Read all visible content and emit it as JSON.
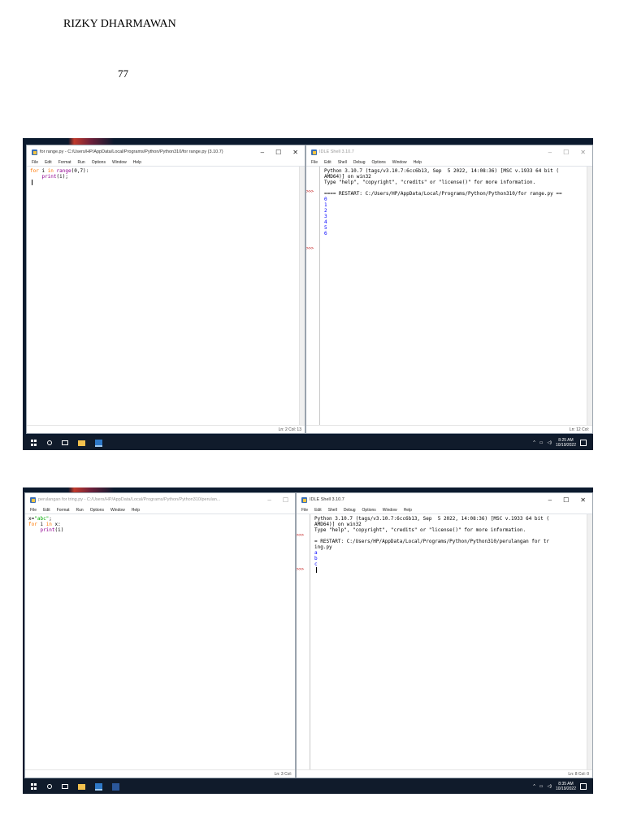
{
  "document": {
    "header": "RIZKY DHARMAWAN",
    "page_number": "77"
  },
  "screenshot1": {
    "editor": {
      "title": "for range.py - C:/Users/HP/AppData/Local/Programs/Python/Python310/for range.py (3.10.7)",
      "controls": {
        "minimize": "–",
        "maximize": "☐",
        "close": "✕"
      },
      "menu": [
        "File",
        "Edit",
        "Format",
        "Run",
        "Options",
        "Window",
        "Help"
      ],
      "code": {
        "kw_for": "for",
        "var_i": " i ",
        "kw_in": "in",
        "fn_range": " range",
        "range_args": "(0,7):",
        "indent": "    ",
        "fn_print": "print",
        "print_args": "(i);"
      },
      "status": "Ln: 2   Col: 13"
    },
    "shell": {
      "title": "IDLE Shell 3.10.7",
      "controls": {
        "minimize": "–",
        "maximize": "☐",
        "close": "✕"
      },
      "menu": [
        "File",
        "Edit",
        "Shell",
        "Debug",
        "Options",
        "Window",
        "Help"
      ],
      "banner": [
        "Python 3.10.7 (tags/v3.10.7:6cc6b13, Sep  5 2022, 14:08:36) [MSC v.1933 64 bit (",
        "AMD64)] on win32",
        "Type \"help\", \"copyright\", \"credits\" or \"license()\" for more information."
      ],
      "restart": "==== RESTART: C:/Users/HP/AppData/Local/Programs/Python/Python310/for range.py ==",
      "output": [
        "0",
        "1",
        "2",
        "3",
        "4",
        "5",
        "6"
      ],
      "prompt": ">>>",
      "status": "Ln: 12   Col: "
    },
    "taskbar": {
      "time": "8:25 AM",
      "date": "10/19/2022"
    }
  },
  "screenshot2": {
    "editor": {
      "title": "perulangan for tring.py - C:/Users/HP/AppData/Local/Programs/Python/Python310/perulan...",
      "controls": {
        "minimize": "–",
        "maximize": "☐"
      },
      "menu": [
        "File",
        "Edit",
        "Format",
        "Run",
        "Options",
        "Window",
        "Help"
      ],
      "code": {
        "assign": "x=",
        "str_val": "\"abc\"",
        "semi": ";",
        "kw_for": "for",
        "var_i": " i ",
        "kw_in": "in",
        "iter": " x:",
        "indent": "    ",
        "fn_print": "print",
        "print_args": "(i)"
      },
      "status": "Ln: 3   Col: "
    },
    "shell": {
      "title": "IDLE Shell 3.10.7",
      "controls": {
        "minimize": "–",
        "maximize": "☐",
        "close": "✕"
      },
      "menu": [
        "File",
        "Edit",
        "Shell",
        "Debug",
        "Options",
        "Window",
        "Help"
      ],
      "banner": [
        "Python 3.10.7 (tags/v3.10.7:6cc6b13, Sep  5 2022, 14:08:36) [MSC v.1933 64 bit (",
        "AMD64)] on win32",
        "Type \"help\", \"copyright\", \"credits\" or \"license()\" for more information."
      ],
      "restart": [
        "= RESTART: C:/Users/HP/AppData/Local/Programs/Python/Python310/perulangan for tr",
        "ing.py"
      ],
      "output": [
        "a",
        "b",
        "c"
      ],
      "prompt": ">>>",
      "status": "Ln: 8   Col: 0"
    },
    "taskbar": {
      "time": "8:35 AM",
      "date": "10/19/2022"
    }
  },
  "icons": [
    "windows-logo",
    "search-icon",
    "task-view-icon",
    "file-explorer-icon",
    "idle-python-icon",
    "word-icon",
    "speaker-icon",
    "network-icon",
    "notification-icon"
  ]
}
